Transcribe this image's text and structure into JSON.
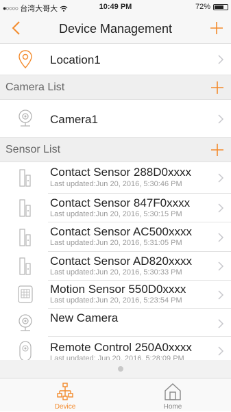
{
  "status": {
    "carrier": "台湾大哥大",
    "time": "10:49 PM",
    "battery": "72%",
    "battery_level": 0.72
  },
  "nav": {
    "title": "Device Management"
  },
  "colors": {
    "accent": "#f38a2b",
    "text": "#222222",
    "subtext": "#9a9a9a",
    "icon": "#b5b5b5"
  },
  "location": {
    "name": "Location1",
    "icon": "location-pin-icon"
  },
  "camera_section": {
    "label": "Camera List"
  },
  "cameras": [
    {
      "name": "Camera1",
      "icon": "camera-icon"
    }
  ],
  "sensor_section": {
    "label": "Sensor List"
  },
  "sensors": [
    {
      "name": "Contact Sensor 288D0xxxx",
      "updated": "Last updated:Jun 20, 2016, 5:30:46 PM",
      "icon": "contact-sensor-icon"
    },
    {
      "name": "Contact Sensor 847F0xxxx",
      "updated": "Last updated:Jun 20, 2016, 5:30:15 PM",
      "icon": "contact-sensor-icon"
    },
    {
      "name": "Contact Sensor AC500xxxx",
      "updated": "Last updated:Jun 20, 2016, 5:31:05 PM",
      "icon": "contact-sensor-icon"
    },
    {
      "name": "Contact Sensor AD820xxxx",
      "updated": "Last updated:Jun 20, 2016, 5:30:33 PM",
      "icon": "contact-sensor-icon"
    },
    {
      "name": "Motion Sensor 550D0xxxx",
      "updated": "Last updated:Jun 20, 2016, 5:23:54 PM",
      "icon": "motion-sensor-icon"
    },
    {
      "name": "New Camera",
      "updated": "",
      "icon": "camera-icon"
    },
    {
      "name": "Remote Control 250A0xxxx",
      "updated": "Last undated: Jun 20, 2016, 5:28:09 PM",
      "icon": "remote-control-icon"
    }
  ],
  "tabs": [
    {
      "label": "Device",
      "icon": "device-tree-icon",
      "active": true
    },
    {
      "label": "Home",
      "icon": "home-icon",
      "active": false
    }
  ]
}
